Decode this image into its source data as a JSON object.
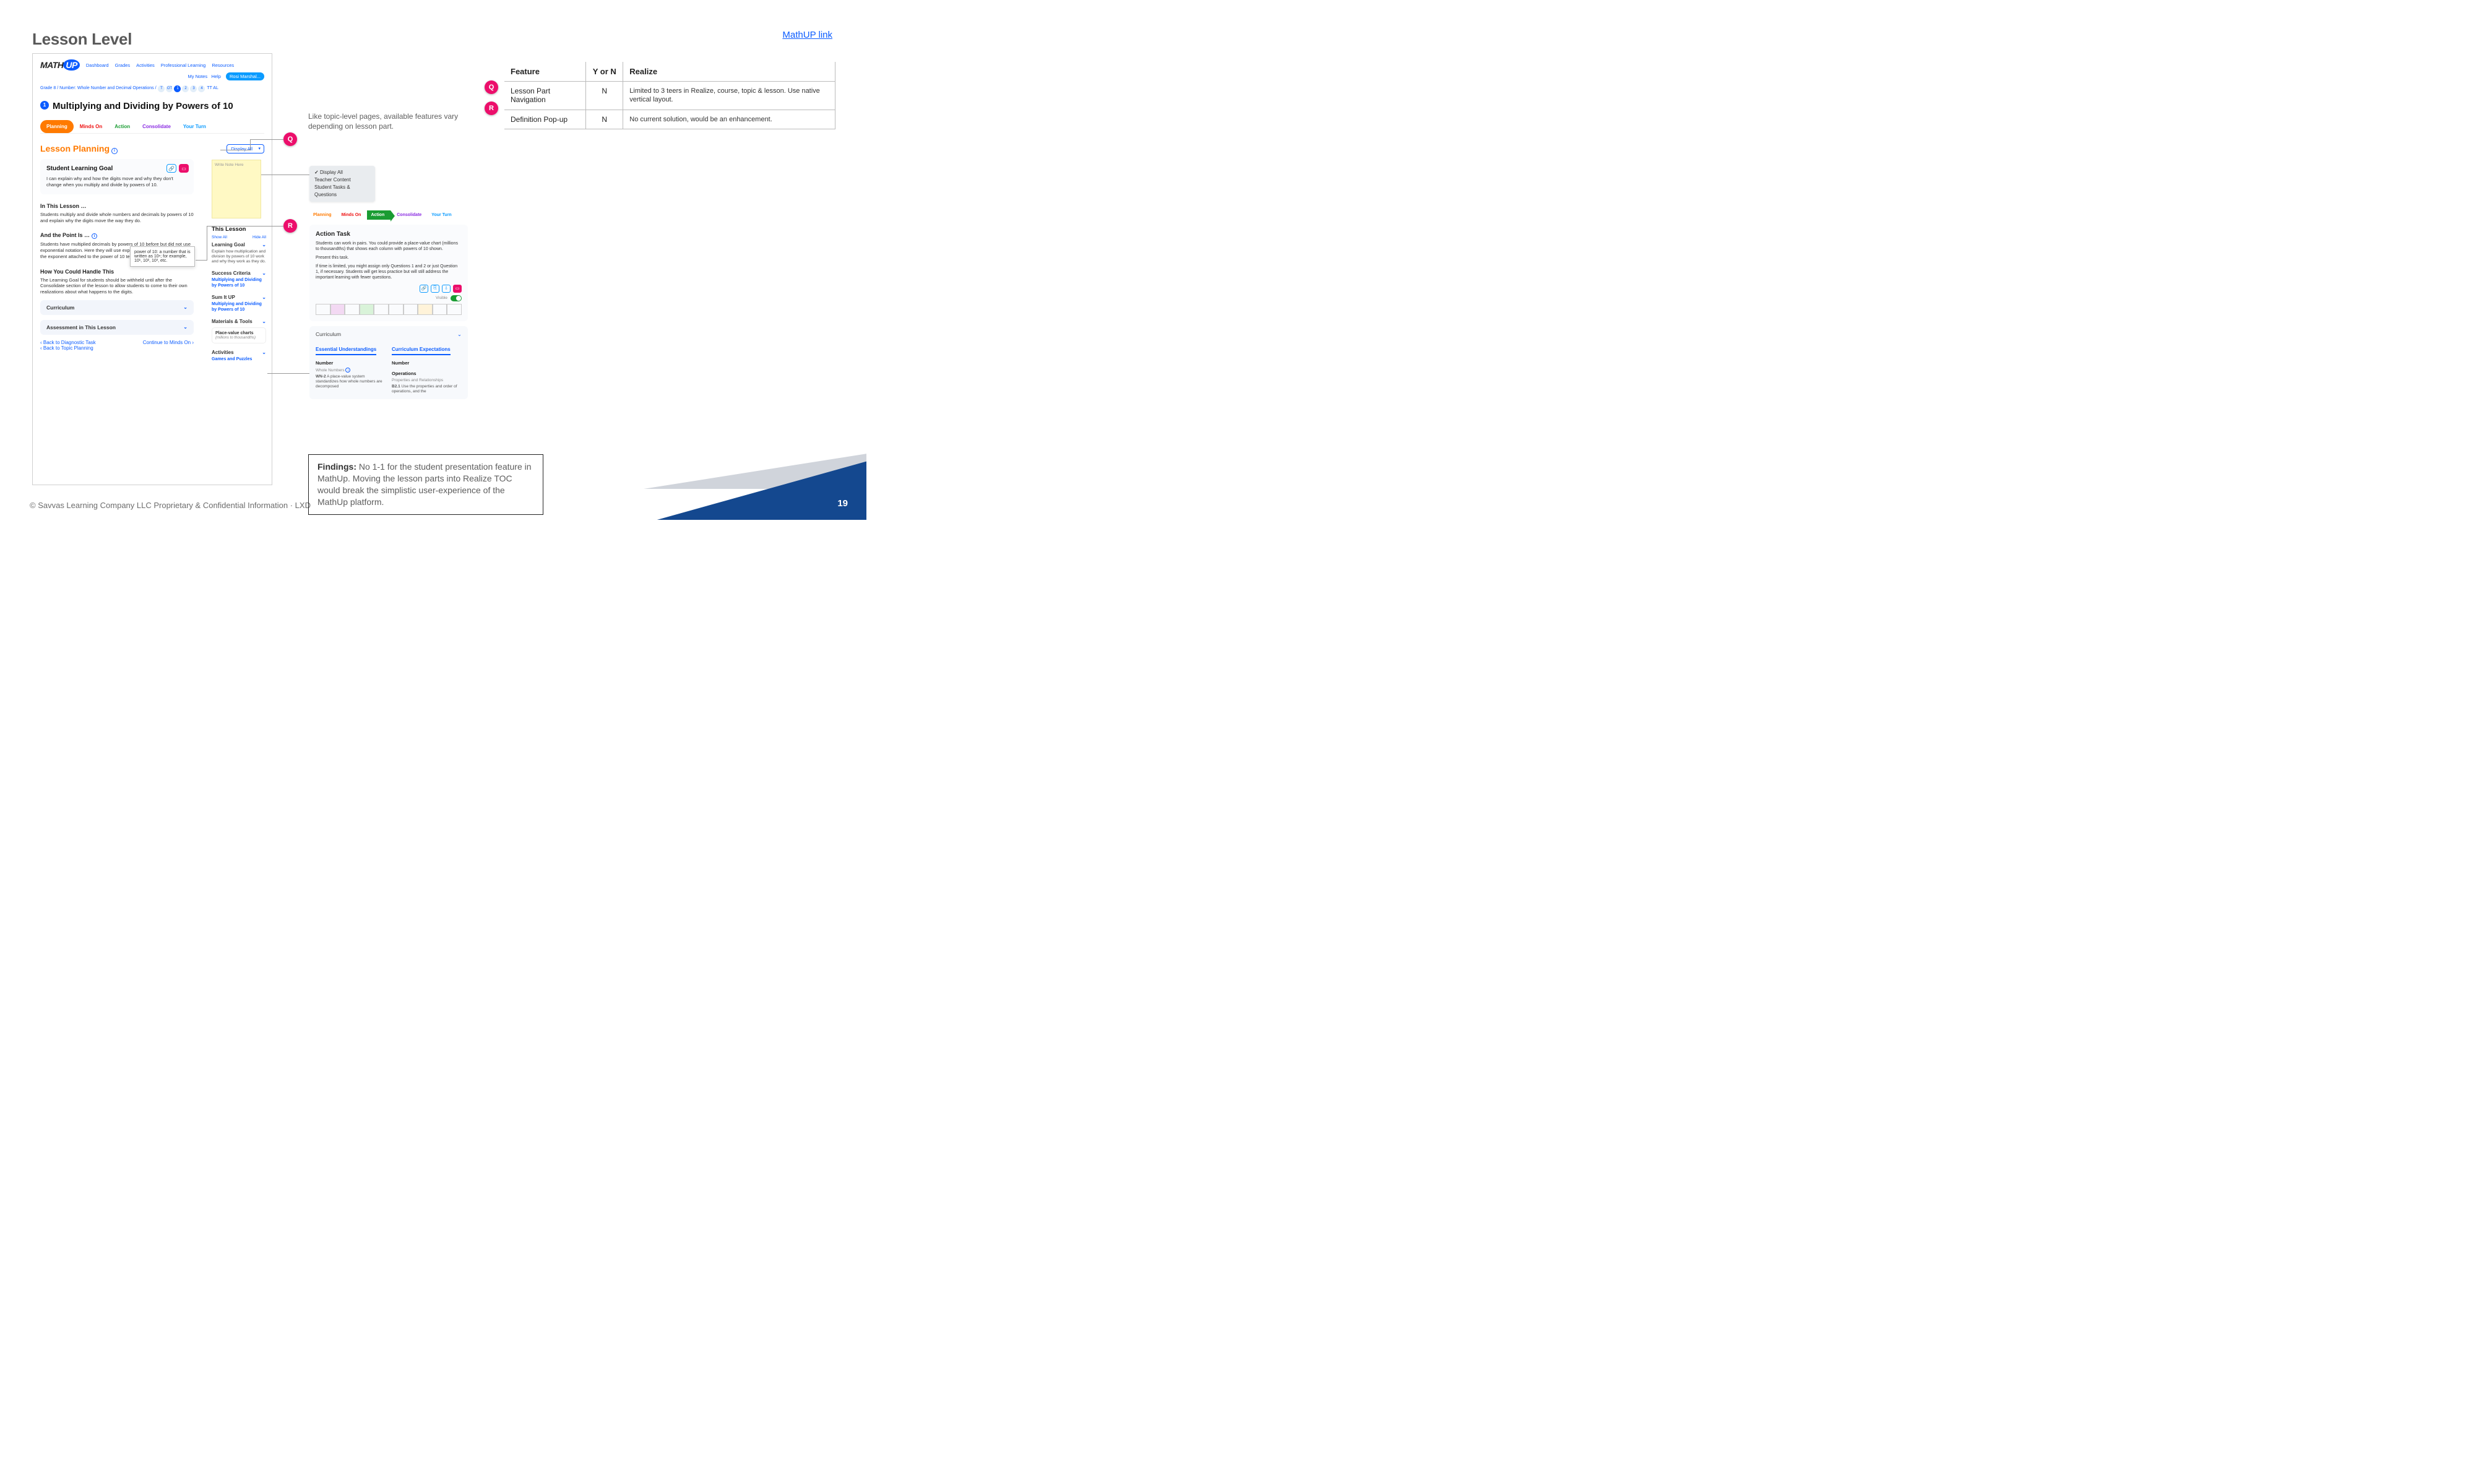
{
  "page": {
    "title": "Lesson Level",
    "link": "MathUP link",
    "copyright": "© Savvas Learning Company LLC   Proprietary & Confidential Information · LXD",
    "page_num": "19"
  },
  "middle_note": "Like topic-level pages, available features vary depending on lesson part.",
  "dropdown_options": {
    "o1": "Display All",
    "o2": "Teacher Content",
    "o3": "Student Tasks & Questions"
  },
  "findings": {
    "label": "Findings:",
    "text": "No 1-1 for the student presentation feature in MathUp. Moving the lesson parts into Realize TOC would break the simplistic user-experience of the MathUp platform."
  },
  "table": {
    "h1": "Feature",
    "h2": "Y or N",
    "h3": "Realize",
    "r1": {
      "badge": "Q",
      "feature": "Lesson Part Navigation",
      "yn": "N",
      "realize": "Limited to 3 teers in Realize, course, topic & lesson. Use native vertical layout."
    },
    "r2": {
      "badge": "R",
      "feature": "Definition Pop-up",
      "yn": "N",
      "realize": "No current solution, would be an enhancement."
    }
  },
  "badges": {
    "q": "Q",
    "r": "R"
  },
  "mock": {
    "logo1": "MATH",
    "logo2": "UP",
    "nav": {
      "n1": "Dashboard",
      "n2": "Grades",
      "n3": "Activities",
      "n4": "Professional Learning",
      "n5": "Resources"
    },
    "subnav": {
      "s1": "My Notes",
      "s2": "Help",
      "pill": "Rosi Marshal..."
    },
    "crumb_text": "Grade 8 / Number: Whole Number and Decimal Operations /",
    "crumb_end": "TT  AL",
    "lesson_num": "1",
    "lesson_title": "Multiplying and Dividing by Powers of 10",
    "parts": {
      "planning": "Planning",
      "minds": "Minds On",
      "action": "Action",
      "cons": "Consolidate",
      "turn": "Your Turn"
    },
    "lp_heading": "Lesson Planning",
    "lp_select": "Display All",
    "slg_title": "Student Learning Goal",
    "slg_text": "I can explain why and how the digits move and why they don't change when you multiply and divide by powers of 10.",
    "tooltip": "power of 10: a number that is written as 10ⁿ; for example, 10¹, 10², 10³, etc.",
    "s1h": "In This Lesson …",
    "s1p": "Students multiply and divide whole numbers and decimals by powers of 10 and explain why the digits move the way they do.",
    "s2h": "And the Point Is …",
    "s2p": "Students have multiplied decimals by powers of 10 before but did not use exponential notation. Here they will use exponential notation and see how the exponent attached to the power of 10 tells how far the digits move.",
    "s3h": "How You Could Handle This",
    "s3p": "The Learning Goal for students should be withheld until after the Consolidate section of the lesson to allow students to come to their own realizations about what happens to the digits.",
    "acc1": "Curriculum",
    "acc2": "Assessment in This Lesson",
    "bl1": "Back to Diagnostic Task",
    "bl2": "Back to Topic Planning",
    "bl3": "Continue to Minds On",
    "side": {
      "sticky": "Write Note Here",
      "title": "This Lesson",
      "show": "Show All",
      "hide": "Hide All",
      "lg": "Learning Goal",
      "lgp": "Explain how multiplication and division by powers of 10 work and why they work as they do.",
      "sc": "Success Criteria",
      "sc_link": "Multiplying and Dividing by Powers of 10",
      "sum": "Sum It UP",
      "mat": "Materials & Tools",
      "mat_name": "Place-value charts",
      "mat_sub": "(millions to thousandths)",
      "act": "Activities",
      "act_link": "Games and Puzzles"
    }
  },
  "action": {
    "title": "Action Task",
    "p1": "Students can work in pairs. You could provide a place-value chart (millions to thousandths) that shows each column with powers of 10 shown.",
    "p2": "Present this task.",
    "p3": "If time is limited, you might assign only Questions 1 and 2 or just Question 1, if necessary. Students will get less practice but will still address the important learning with fewer questions.",
    "visible": "Visible",
    "curr": "Curriculum",
    "col1": "Essential Understandings",
    "col2": "Curriculum Expectations",
    "n1": "Number",
    "wn": "Whole Numbers",
    "wn2": "WN-2",
    "wn2t": "A place-value system standardizes how whole numbers are decomposed",
    "n2": "Number",
    "ops": "Operations",
    "pr": "Properties and Relationships",
    "b21": "B2.1",
    "b21t": "Use the properties and order of operations, and the"
  }
}
